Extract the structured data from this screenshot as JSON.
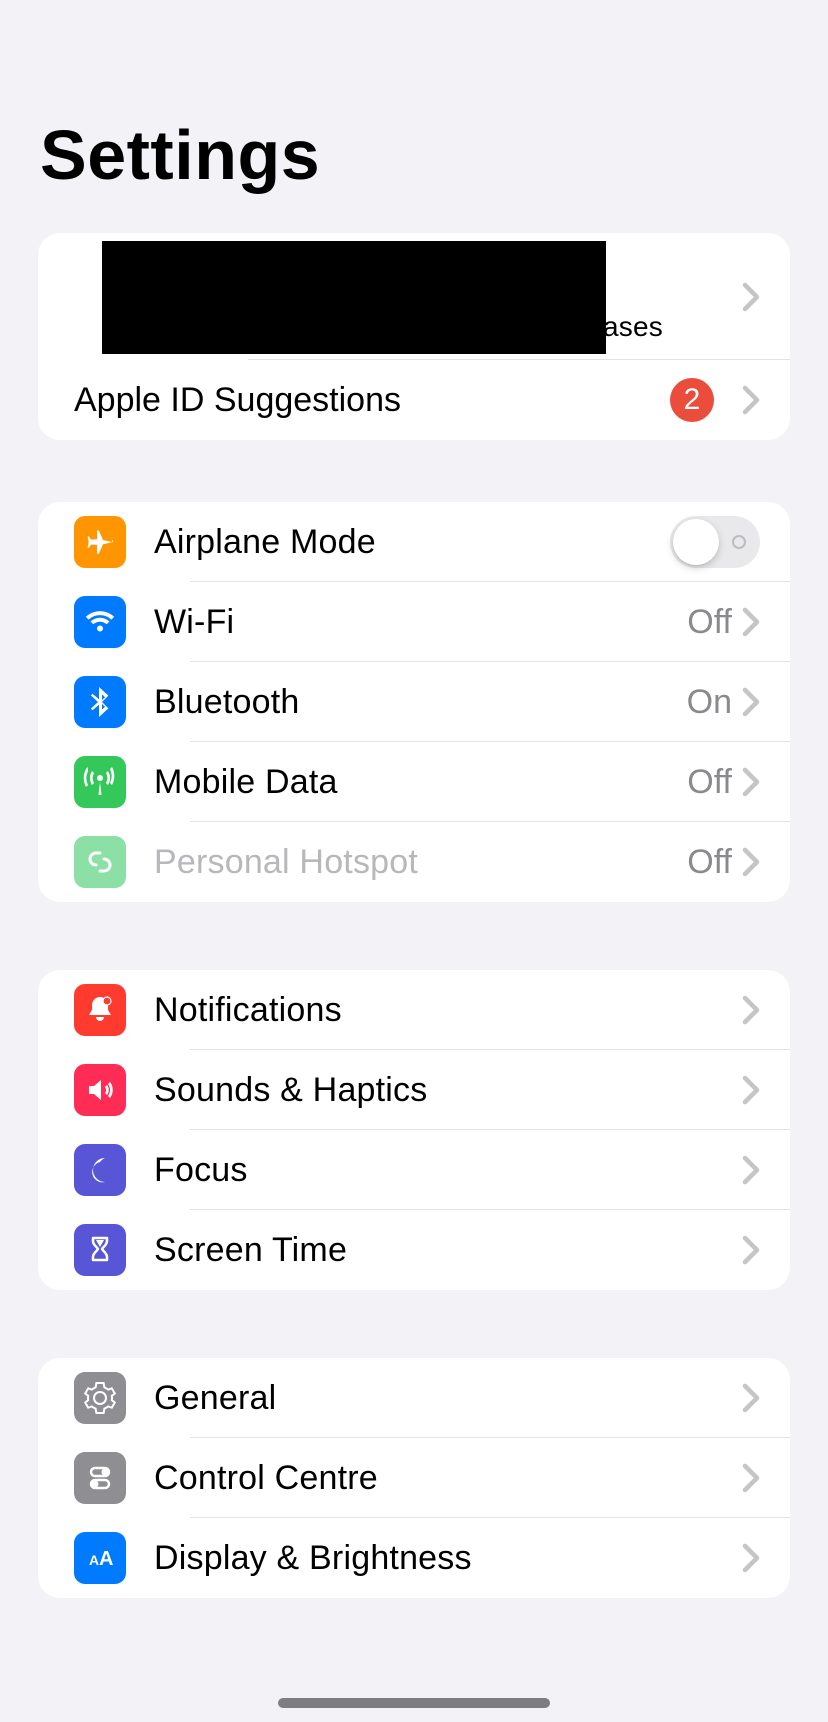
{
  "page_title": "Settings",
  "profile": {
    "sub_visible": "ases",
    "appleid_label": "Apple ID Suggestions",
    "appleid_badge": "2"
  },
  "colors": {
    "orange": "#ff9500",
    "blue": "#007aff",
    "blue2": "#277cff",
    "green": "#34c759",
    "green_dim": "#8de0a5",
    "red": "#ff3b30",
    "pink": "#ff2d55",
    "indigo": "#5856d6",
    "indigo2": "#5856d6",
    "gray": "#8e8e93"
  },
  "conn": {
    "airplane": {
      "label": "Airplane Mode",
      "on": false
    },
    "wifi": {
      "label": "Wi-Fi",
      "value": "Off"
    },
    "bluetooth": {
      "label": "Bluetooth",
      "value": "On"
    },
    "mobile": {
      "label": "Mobile Data",
      "value": "Off"
    },
    "hotspot": {
      "label": "Personal Hotspot",
      "value": "Off"
    }
  },
  "notif": {
    "notifications": {
      "label": "Notifications"
    },
    "sounds": {
      "label": "Sounds & Haptics"
    },
    "focus": {
      "label": "Focus"
    },
    "screentime": {
      "label": "Screen Time"
    }
  },
  "general": {
    "general": {
      "label": "General"
    },
    "controlcentre": {
      "label": "Control Centre"
    },
    "display": {
      "label": "Display & Brightness"
    }
  }
}
